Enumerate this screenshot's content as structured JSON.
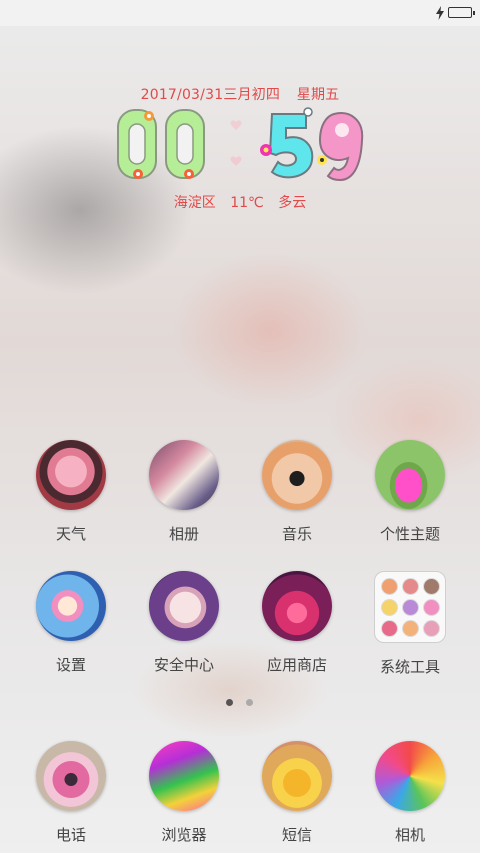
{
  "status_bar": {
    "icons": [
      "charging-icon",
      "battery-icon"
    ]
  },
  "widget": {
    "date": "2017/03/31",
    "lunar_date": "三月初四",
    "weekday": "星期五",
    "time_hour": "00",
    "time_minute": "59",
    "location": "海淀区",
    "temperature": "11℃",
    "condition": "多云",
    "text_color": "#e04a4a"
  },
  "apps_row1": [
    {
      "label": "天气",
      "icon": "pink-bear-icon"
    },
    {
      "label": "相册",
      "icon": "sneakers-photo-icon"
    },
    {
      "label": "音乐",
      "icon": "nail-art-icon"
    },
    {
      "label": "个性主题",
      "icon": "pink-heels-icon"
    }
  ],
  "apps_row2": [
    {
      "label": "设置",
      "icon": "bottle-photo-icon"
    },
    {
      "label": "安全中心",
      "icon": "heart-cookie-icon"
    },
    {
      "label": "应用商店",
      "icon": "heart-bokeh-icon"
    },
    {
      "label": "系统工具",
      "icon": "folder-icon"
    }
  ],
  "page_indicator": {
    "current": 1,
    "total": 2
  },
  "dock": [
    {
      "label": "电话",
      "icon": "flower-brooch-icon"
    },
    {
      "label": "浏览器",
      "icon": "bracelets-icon"
    },
    {
      "label": "短信",
      "icon": "nail-polish-icon"
    },
    {
      "label": "相机",
      "icon": "lollipops-icon"
    }
  ]
}
